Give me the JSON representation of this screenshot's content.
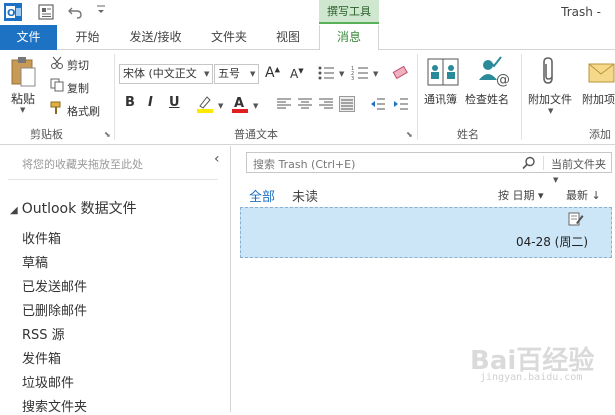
{
  "app": {
    "title": "Trash -",
    "context_group": "撰写工具"
  },
  "tabs": [
    {
      "label": "文件"
    },
    {
      "label": "开始"
    },
    {
      "label": "发送/接收"
    },
    {
      "label": "文件夹"
    },
    {
      "label": "视图"
    },
    {
      "label": "消息"
    }
  ],
  "ribbon": {
    "clipboard": {
      "paste": "粘贴",
      "cut": "剪切",
      "copy": "复制",
      "format_painter": "格式刷",
      "group_label": "剪贴板"
    },
    "basic_text": {
      "font_name": "宋体 (中文正文",
      "font_size": "五号",
      "group_label": "普通文本"
    },
    "names": {
      "address_book": "通讯簿",
      "check_names": "检查姓名",
      "group_label": "姓名"
    },
    "include": {
      "attach_file": "附加文件",
      "attach_item": "附加项",
      "group_label": "添加"
    }
  },
  "left_pane": {
    "favorites_hint": "将您的收藏夹拖放至此处",
    "account": "Outlook 数据文件",
    "folders": [
      "收件箱",
      "草稿",
      "已发送邮件",
      "已删除邮件",
      "RSS 源",
      "发件箱",
      "垃圾邮件",
      "搜索文件夹"
    ]
  },
  "message_list": {
    "search_placeholder": "搜索 Trash (Ctrl+E)",
    "search_scope": "当前文件夹",
    "filter_all": "全部",
    "filter_unread": "未读",
    "sort_by": "按 日期 ▾",
    "sort_order": "最新 ↓",
    "items": [
      {
        "date": "04-28 (周二)"
      }
    ]
  },
  "watermark": {
    "main": "Bai百经验",
    "sub": "jingyan.baidu.com"
  },
  "colors": {
    "accent": "#1e72c3",
    "context_green": "#3a8a3a",
    "selected_item": "#cde6f7"
  }
}
